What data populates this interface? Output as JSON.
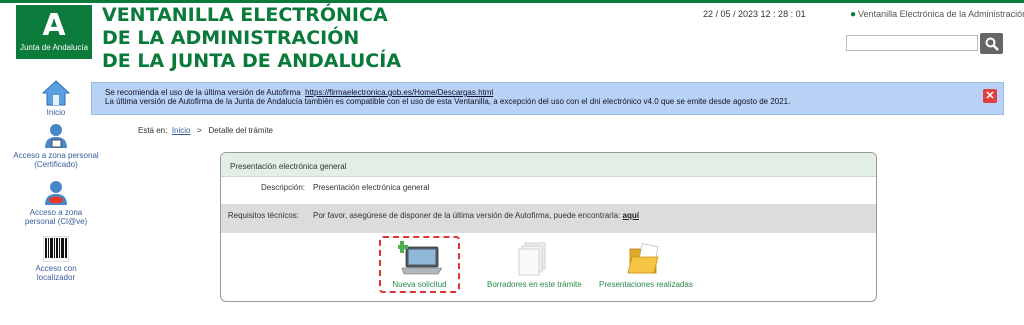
{
  "header": {
    "logo_glyph": "A",
    "logo_text": "Junta de Andalucía",
    "title_lines": [
      "VENTANILLA ELECTRÓNICA",
      "DE LA ADMINISTRACIÓN",
      "DE LA JUNTA DE ANDALUCÍA"
    ],
    "datetime": "22 / 05 / 2023   12 : 28 : 01",
    "site_link": "Ventanilla Electrónica de la Administración",
    "search": {
      "value": "",
      "placeholder": ""
    }
  },
  "sidebar": {
    "items": [
      {
        "label": "Inicio",
        "icon": "home-icon"
      },
      {
        "label": "Acceso a zona personal (Certificado)",
        "icon": "user-certificate-icon"
      },
      {
        "label": "Acceso a zona personal (Cl@ve)",
        "icon": "user-clave-icon"
      },
      {
        "label": "Acceso con localizador",
        "icon": "barcode-icon"
      }
    ]
  },
  "banner": {
    "line1_prefix": "Se recomienda el uso de la última versión de Autofirma",
    "line1_link": "https://firmaelectronica.gob.es/Home/Descargas.html",
    "line2": "La última versión de Autofirma de la Junta de Andalucía también es compatible con el uso de esta Ventanilla, a excepción del uso con el dni electrónico v4.0 que se emite desde agosto de 2021.",
    "close_glyph": "✕"
  },
  "breadcrumb": {
    "prefix": "Está en:",
    "home": "Inicio",
    "separator": ">",
    "current": "Detalle del trámite"
  },
  "panel": {
    "title": "Presentación electrónica general",
    "description_label": "Descripción:",
    "description_value": "Presentación electrónica general",
    "requirements_label": "Requisitos técnicos:",
    "requirements_text": "Por favor, asegúrese de disponer de la última versión de Autofirma, puede encontrarla:",
    "requirements_link": "aquí",
    "actions": [
      {
        "label": "Nueva solicitud",
        "icon": "new-request-icon"
      },
      {
        "label": "Borradores en este trámite",
        "icon": "drafts-icon"
      },
      {
        "label": "Presentaciones realizadas",
        "icon": "folder-icon"
      }
    ]
  },
  "colors": {
    "brand_green": "#0b7a3b",
    "banner_blue": "#b8d2f5",
    "link_blue": "#3a5c9c",
    "highlight_red": "#dd3333"
  }
}
